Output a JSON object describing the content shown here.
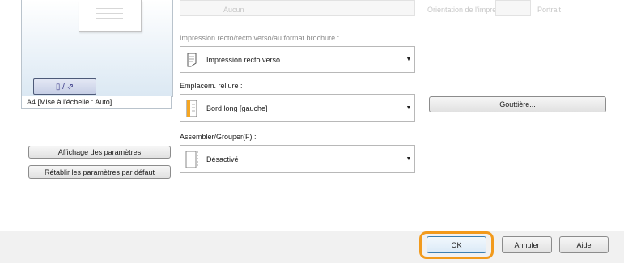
{
  "top_row": {
    "value": "Aucun",
    "label_right": "Orientation de l'impression",
    "value_right": "Portrait"
  },
  "preview": {
    "toggle_glyph": "▯ / ⇗",
    "caption": "A4 [Mise à l'échelle : Auto]"
  },
  "left_buttons": {
    "show_settings": "Affichage des paramètres",
    "restore_defaults": "Rétablir les paramètres par défaut"
  },
  "duplex": {
    "label": "Impression recto/recto verso/au format brochure :",
    "value": "Impression recto verso"
  },
  "binding": {
    "label": "Emplacem. reliure :",
    "value": "Bord long [gauche]"
  },
  "gutter_button": "Gouttière...",
  "collate": {
    "label": "Assembler/Grouper(F) :",
    "value": "Désactivé"
  },
  "dialog_buttons": {
    "ok": "OK",
    "cancel": "Annuler",
    "help": "Aide"
  },
  "colors": {
    "ok_highlight": "#f29a1c",
    "binding_accent": "#f5a623",
    "toggle_border": "#4d5a78"
  }
}
